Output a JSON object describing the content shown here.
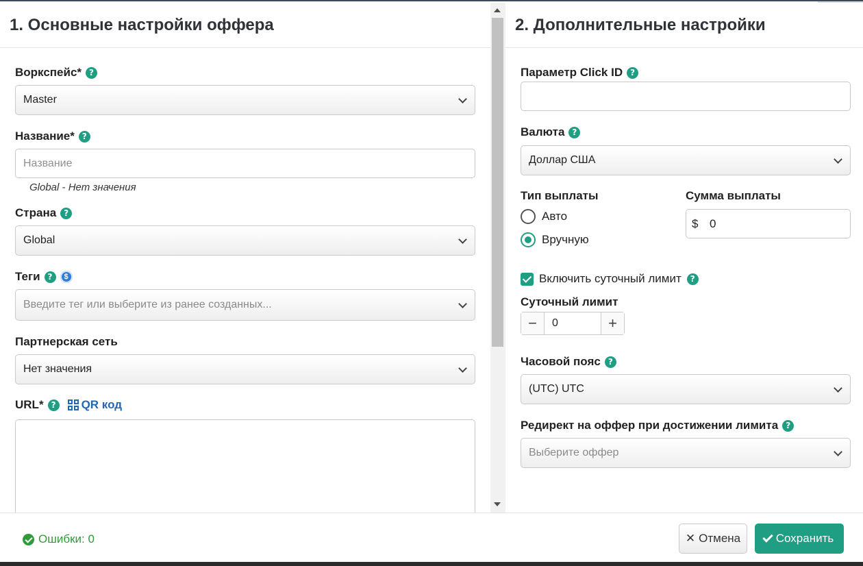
{
  "left": {
    "title": "1. Основные настройки оффера",
    "workspace": {
      "label": "Воркспейс*",
      "value": "Master"
    },
    "name": {
      "label": "Название*",
      "placeholder": "Название",
      "hint": "Global - Нет значения"
    },
    "country": {
      "label": "Страна",
      "value": "Global"
    },
    "tags": {
      "label": "Теги",
      "placeholder": "Введите тег или выберите из ранее созданных..."
    },
    "network": {
      "label": "Партнерская сеть",
      "value": "Нет значения"
    },
    "url": {
      "label": "URL*",
      "qr_label": "QR код"
    }
  },
  "right": {
    "title": "2. Дополнительные настройки",
    "clickid": {
      "label": "Параметр Click ID"
    },
    "currency": {
      "label": "Валюта",
      "value": "Доллар США"
    },
    "payout_type": {
      "label": "Тип выплаты",
      "options": [
        "Авто",
        "Вручную"
      ],
      "selected": "Вручную"
    },
    "payout_sum": {
      "label": "Сумма выплаты",
      "currency_symbol": "$",
      "value": "0"
    },
    "daily_limit_toggle": {
      "label": "Включить суточный лимит",
      "checked": true
    },
    "daily_limit": {
      "label": "Суточный лимит",
      "value": "0",
      "minus": "−",
      "plus": "+"
    },
    "timezone": {
      "label": "Часовой пояс",
      "value": "(UTC) UTC"
    },
    "redirect": {
      "label": "Редирект на оффер при достижении лимита",
      "placeholder": "Выберите оффер"
    }
  },
  "footer": {
    "errors": "Ошибки: 0",
    "cancel_icon": "✕",
    "cancel": "Отмена",
    "save": "Сохранить"
  },
  "help_glyph": "?",
  "dollar_glyph": "$",
  "colors": {
    "accent": "#1f9e84",
    "link": "#2267b3",
    "success": "#2f9b3b"
  }
}
